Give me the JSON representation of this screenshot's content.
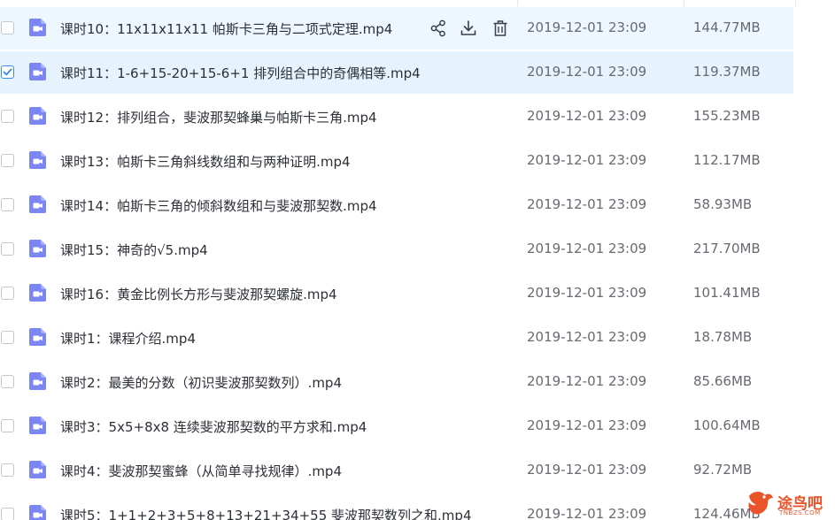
{
  "rows": [
    {
      "name": "课时10：11x11x11x11 帕斯卡三角与二项式定理.mp4",
      "date": "2019-12-01 23:09",
      "size": "144.77MB",
      "checked": false,
      "state": "hover",
      "show_actions": true
    },
    {
      "name": "课时11：1-6+15-20+15-6+1 排列组合中的奇偶相等.mp4",
      "date": "2019-12-01 23:09",
      "size": "119.37MB",
      "checked": true,
      "state": "selected",
      "show_actions": false
    },
    {
      "name": "课时12：排列组合，斐波那契蜂巢与帕斯卡三角.mp4",
      "date": "2019-12-01 23:09",
      "size": "155.23MB",
      "checked": false,
      "state": "normal",
      "show_actions": false
    },
    {
      "name": "课时13：帕斯卡三角斜线数组和与两种证明.mp4",
      "date": "2019-12-01 23:09",
      "size": "112.17MB",
      "checked": false,
      "state": "normal",
      "show_actions": false
    },
    {
      "name": "课时14：帕斯卡三角的倾斜数组和与斐波那契数.mp4",
      "date": "2019-12-01 23:09",
      "size": "58.93MB",
      "checked": false,
      "state": "normal",
      "show_actions": false
    },
    {
      "name": "课时15：神奇的√5.mp4",
      "date": "2019-12-01 23:09",
      "size": "217.70MB",
      "checked": false,
      "state": "normal",
      "show_actions": false
    },
    {
      "name": "课时16：黄金比例长方形与斐波那契螺旋.mp4",
      "date": "2019-12-01 23:09",
      "size": "101.41MB",
      "checked": false,
      "state": "normal",
      "show_actions": false
    },
    {
      "name": "课时1：课程介绍.mp4",
      "date": "2019-12-01 23:09",
      "size": "18.78MB",
      "checked": false,
      "state": "normal",
      "show_actions": false
    },
    {
      "name": "课时2：最美的分数（初识斐波那契数列）.mp4",
      "date": "2019-12-01 23:09",
      "size": "85.66MB",
      "checked": false,
      "state": "normal",
      "show_actions": false
    },
    {
      "name": "课时3：5x5+8x8 连续斐波那契数的平方求和.mp4",
      "date": "2019-12-01 23:09",
      "size": "100.64MB",
      "checked": false,
      "state": "normal",
      "show_actions": false
    },
    {
      "name": "课时4：斐波那契蜜蜂（从简单寻找规律）.mp4",
      "date": "2019-12-01 23:09",
      "size": "92.72MB",
      "checked": false,
      "state": "normal",
      "show_actions": false
    },
    {
      "name": "课时5：1+1+2+3+5+8+13+21+34+55 斐波那契数列之和.mp4",
      "date": "2019-12-01 23:09",
      "size": "124.46MB",
      "checked": false,
      "state": "normal",
      "show_actions": false
    }
  ],
  "actions": [
    {
      "name": "share-icon"
    },
    {
      "name": "download-icon"
    },
    {
      "name": "delete-icon"
    }
  ],
  "watermark": {
    "text": "途鸟吧",
    "sub": "TNBZS.COM"
  },
  "colors": {
    "accent": "#3b8bf0",
    "file_icon": "#7b86f2",
    "hover_bg": "#eef7fe",
    "selected_bg": "#e6f3fc",
    "text": "#2b2f36",
    "meta_text": "#666a71",
    "watermark": "#e9542a"
  }
}
